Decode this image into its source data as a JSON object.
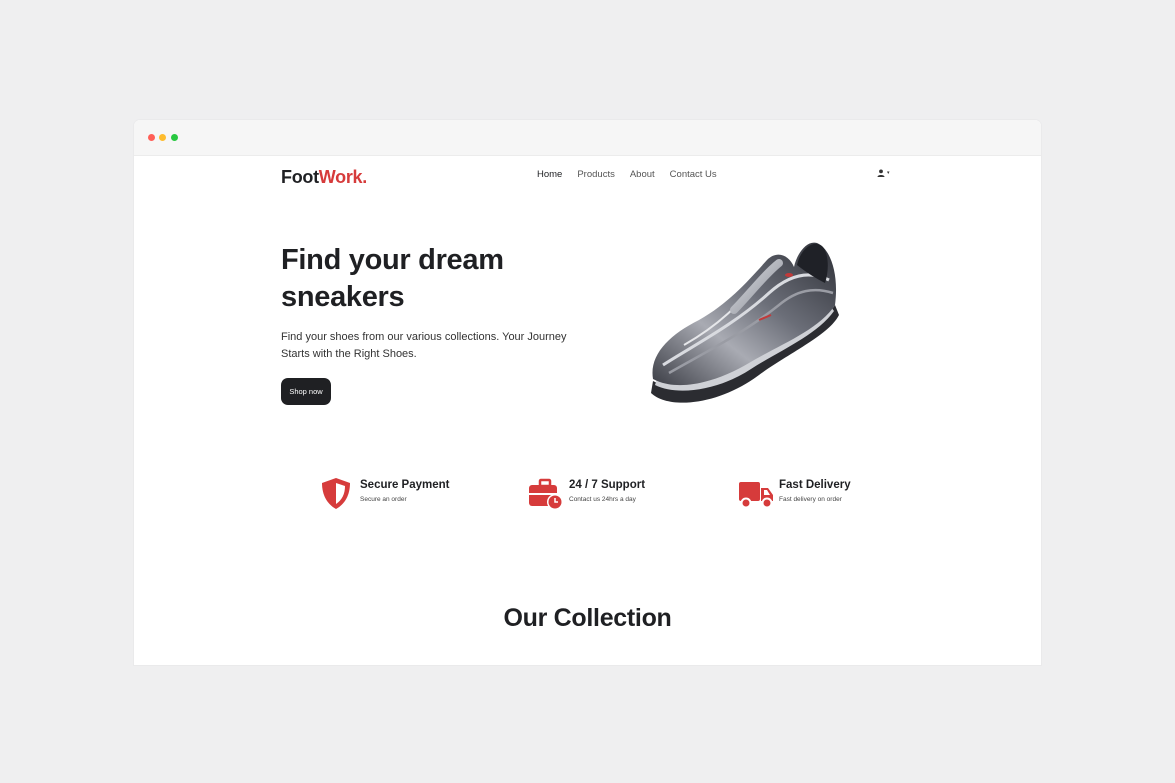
{
  "brand": {
    "part1": "Foot",
    "part2": "Work.",
    "accent": "#d63b3b"
  },
  "nav": {
    "items": [
      "Home",
      "Products",
      "About",
      "Contact Us"
    ],
    "active": "Home"
  },
  "user": {
    "caret": "▾"
  },
  "hero": {
    "title": "Find your dream sneakers",
    "text": "Find your shoes from our various collections. Your Journey Starts with the Right Shoes.",
    "button": "Shop now"
  },
  "features": [
    {
      "title": "Secure Payment",
      "subtitle": "Secure an order",
      "icon": "shield-icon"
    },
    {
      "title": "24 / 7 Support",
      "subtitle": "Contact us 24hrs a day",
      "icon": "briefcase-clock-icon"
    },
    {
      "title": "Fast Delivery",
      "subtitle": "Fast delivery on order",
      "icon": "truck-icon"
    }
  ],
  "collection": {
    "title": "Our Collection"
  }
}
